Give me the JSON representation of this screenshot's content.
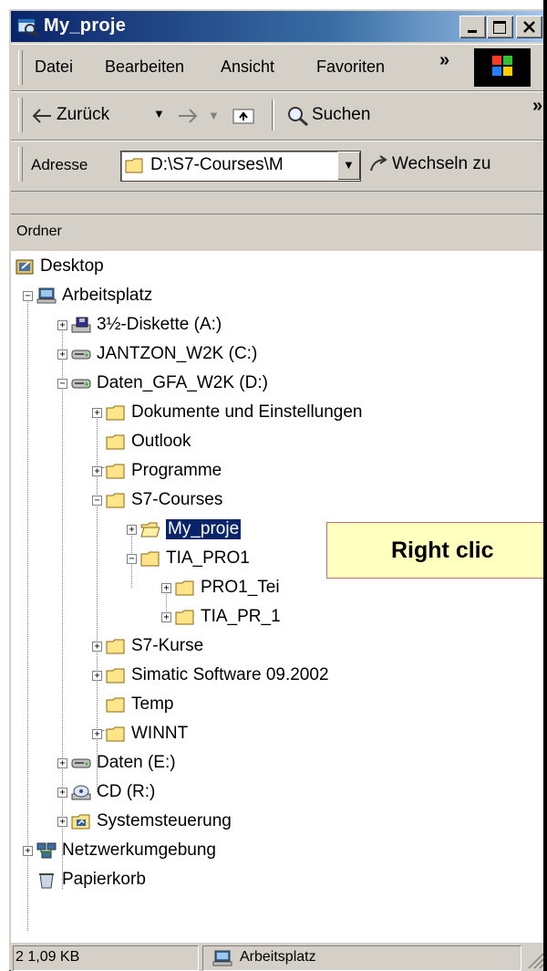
{
  "window": {
    "title": "My_proje",
    "colors": {
      "titlebar_start": "#0a246a",
      "titlebar_end": "#a6caf0",
      "chrome": "#d4d0c8",
      "selection": "#0a246a",
      "callout_bg": "#ffffc0"
    }
  },
  "menubar": {
    "items": [
      "Datei",
      "Bearbeiten",
      "Ansicht",
      "Favoriten"
    ],
    "overflow": "»"
  },
  "toolbar": {
    "back_label": "Zurück",
    "search_label": "Suchen",
    "overflow": "»"
  },
  "addressbar": {
    "label": "Adresse",
    "value": "D:\\S7-Courses\\M",
    "go_label": "Wechseln zu"
  },
  "folders_pane": {
    "header": "Ordner",
    "tree": [
      {
        "label": "Desktop",
        "icon": "desktop-icon"
      },
      {
        "label": "Arbeitsplatz",
        "icon": "computer-icon"
      },
      {
        "label": "3½-Diskette (A:)",
        "icon": "floppy-drive-icon"
      },
      {
        "label": "JANTZON_W2K (C:)",
        "icon": "hard-drive-icon"
      },
      {
        "label": "Daten_GFA_W2K (D:)",
        "icon": "hard-drive-icon"
      },
      {
        "label": "Dokumente und Einstellungen",
        "icon": "folder-icon"
      },
      {
        "label": "Outlook",
        "icon": "folder-icon"
      },
      {
        "label": "Programme",
        "icon": "folder-icon"
      },
      {
        "label": "S7-Courses",
        "icon": "folder-icon"
      },
      {
        "label": "My_proje",
        "icon": "open-folder-icon",
        "selected": true
      },
      {
        "label": "TIA_PRO1",
        "icon": "folder-icon"
      },
      {
        "label": "PRO1_Tei",
        "icon": "folder-icon"
      },
      {
        "label": "TIA_PR_1",
        "icon": "folder-icon"
      },
      {
        "label": "S7-Kurse",
        "icon": "folder-icon"
      },
      {
        "label": "Simatic Software 09.2002",
        "icon": "folder-icon"
      },
      {
        "label": "Temp",
        "icon": "folder-icon"
      },
      {
        "label": "WINNT",
        "icon": "folder-icon"
      },
      {
        "label": "Daten (E:)",
        "icon": "hard-drive-icon"
      },
      {
        "label": "CD (R:)",
        "icon": "cd-drive-icon"
      },
      {
        "label": "Systemsteuerung",
        "icon": "control-panel-icon"
      },
      {
        "label": "Netzwerkumgebung",
        "icon": "network-icon"
      },
      {
        "label": "Papierkorb",
        "icon": "recycle-bin-icon"
      }
    ]
  },
  "callout": {
    "text": "Right clic"
  },
  "statusbar": {
    "size": "2 1,09 KB",
    "location": "Arbeitsplatz"
  }
}
